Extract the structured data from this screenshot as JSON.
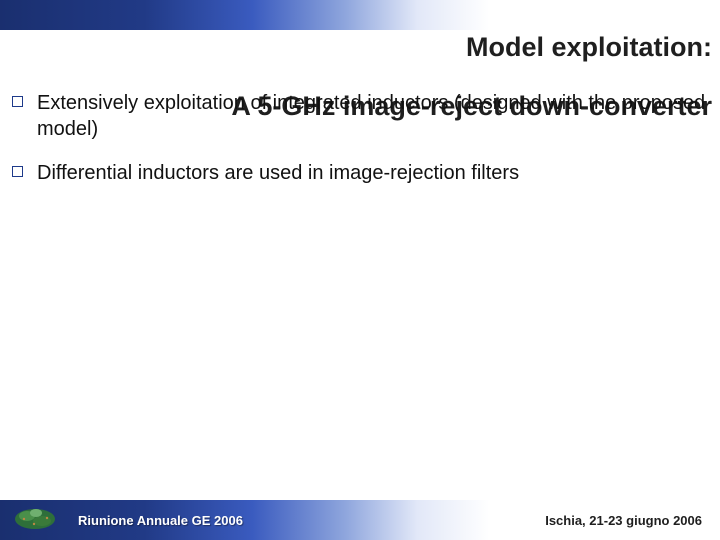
{
  "title": {
    "line1": "Model exploitation:",
    "line2": "A 5-GHz image-reject down-converter"
  },
  "bullets": [
    "Extensively exploitation of integrated inductors (designed with the proposed model)",
    "Differential inductors are used in image-rejection filters"
  ],
  "footer": {
    "left": "Riunione Annuale GE 2006",
    "right": "Ischia, 21-23 giugno 2006"
  },
  "colors": {
    "accent": "#1e3a8a",
    "gradient_dark": "#1a2f6f",
    "gradient_light": "#ffffff"
  }
}
